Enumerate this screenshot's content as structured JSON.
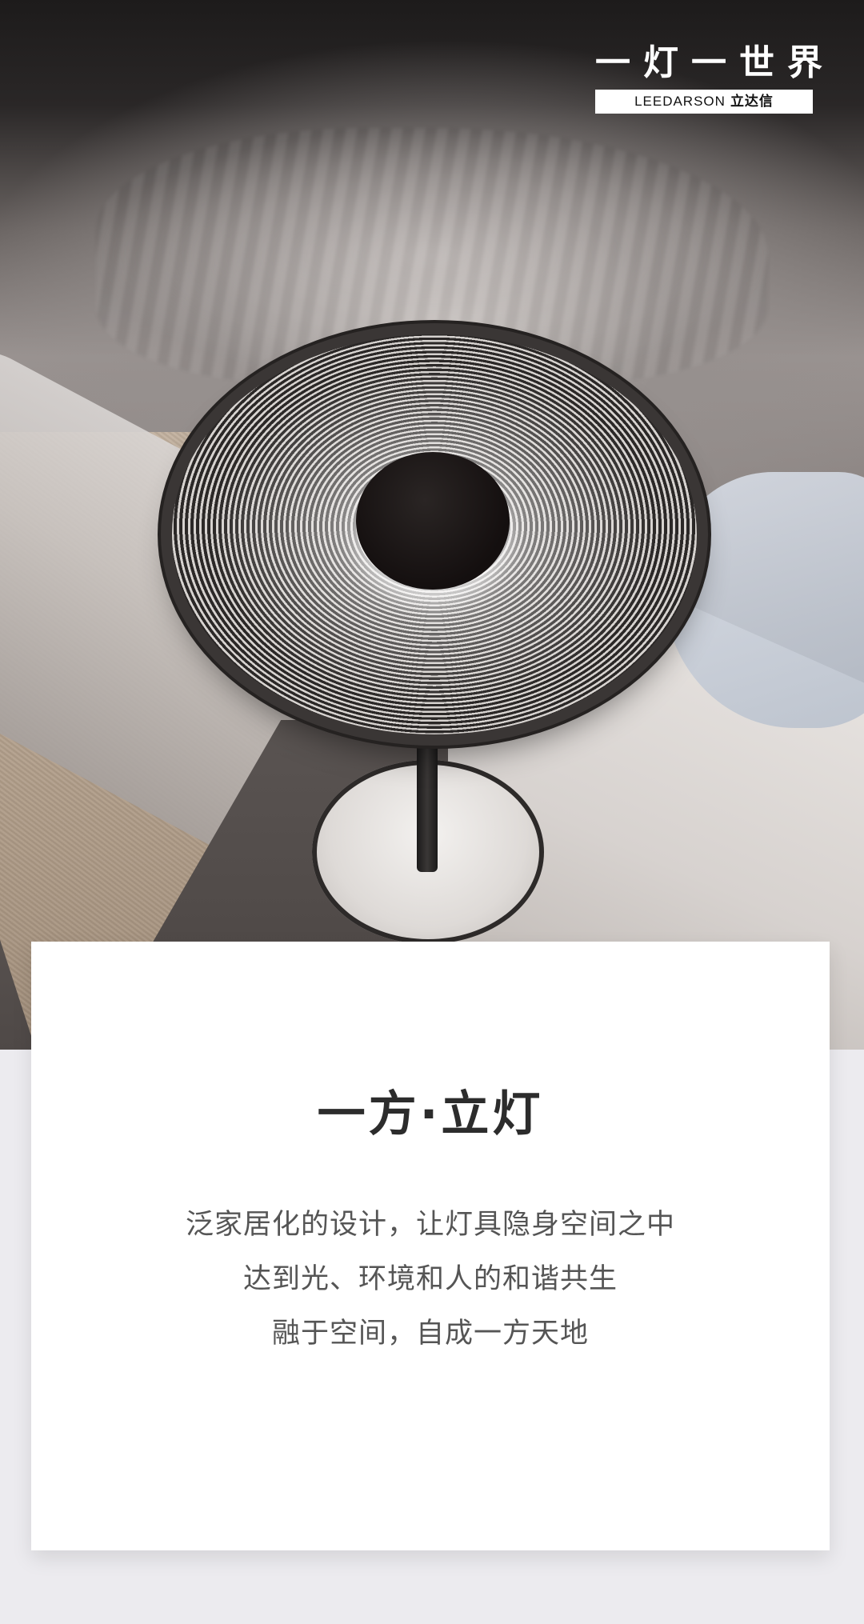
{
  "logo": {
    "title": "一灯一世界",
    "brand_en": "LEEDARSON",
    "brand_cn": "立达信"
  },
  "card": {
    "title": "一方·立灯",
    "lines": [
      "泛家居化的设计，让灯具隐身空间之中",
      "达到光、环境和人的和谐共生",
      "融于空间，自成一方天地"
    ]
  }
}
